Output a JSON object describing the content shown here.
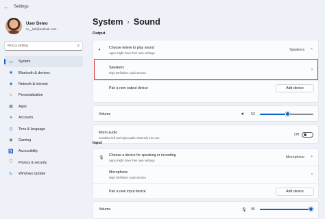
{
  "window": {
    "title": "Settings",
    "back_icon": "back-arrow-icon"
  },
  "user": {
    "name": "User Demo",
    "email": "m__lab@outlook.com"
  },
  "search": {
    "placeholder": "Find a setting",
    "icon": "search-icon"
  },
  "sidebar": {
    "items": [
      {
        "label": "System",
        "icon": "system-icon",
        "color": "#0a63c9",
        "active": true
      },
      {
        "label": "Bluetooth & devices",
        "icon": "bluetooth-icon",
        "color": "#1a73d6"
      },
      {
        "label": "Network & internet",
        "icon": "network-icon",
        "color": "#2b88d8"
      },
      {
        "label": "Personalization",
        "icon": "brush-icon",
        "color": "#d7853a"
      },
      {
        "label": "Apps",
        "icon": "apps-icon",
        "color": "#5a6b7e"
      },
      {
        "label": "Accounts",
        "icon": "accounts-icon",
        "color": "#2ea44f"
      },
      {
        "label": "Time & language",
        "icon": "time-language-icon",
        "color": "#1a73d6"
      },
      {
        "label": "Gaming",
        "icon": "gaming-icon",
        "color": "#6b6b6b"
      },
      {
        "label": "Accessibility",
        "icon": "accessibility-icon",
        "color": "#1a73d6"
      },
      {
        "label": "Privacy & security",
        "icon": "shield-icon",
        "color": "#6b6b6b"
      },
      {
        "label": "Windows Update",
        "icon": "update-icon",
        "color": "#1a73d6"
      }
    ]
  },
  "breadcrumb": {
    "parent": "System",
    "separator": "›",
    "current": "Sound"
  },
  "output": {
    "section_label": "Output",
    "choose": {
      "title": "Choose where to play sound",
      "subtitle": "Apps might have their own settings",
      "value": "Speakers",
      "expanded_icon": "chevron-up-icon"
    },
    "speakers": {
      "title": "Speakers",
      "subtitle": "High Definition Audio Device"
    },
    "pair": {
      "label": "Pair a new output device",
      "button": "Add device"
    },
    "volume": {
      "label": "Volume",
      "value": "53",
      "level": 53
    },
    "mono": {
      "title": "Mono audio",
      "subtitle": "Combine left and right audio channels into one",
      "state": "Off"
    }
  },
  "input": {
    "section_label": "Input",
    "choose": {
      "title": "Choose a device for speaking or recording",
      "subtitle": "Apps might have their own settings",
      "value": "Microphone"
    },
    "microphone": {
      "title": "Microphone",
      "subtitle": "High Definition Audio Device"
    },
    "pair": {
      "label": "Pair a new input device",
      "button": "Add device"
    },
    "volume": {
      "label": "Volume",
      "value": "96",
      "level": 96
    }
  },
  "colors": {
    "accent": "#0a63c9",
    "highlight_border": "#d03030"
  }
}
